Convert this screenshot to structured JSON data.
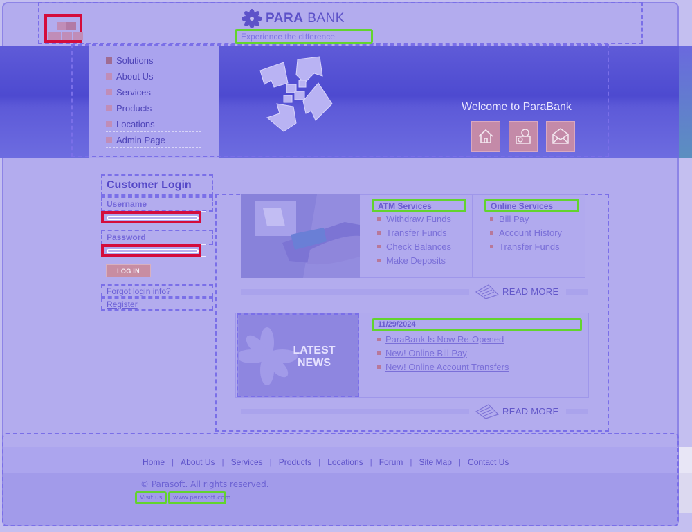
{
  "header": {
    "brand_prefix": "PARA",
    "brand_suffix": "BANK",
    "tagline": "Experience the difference"
  },
  "menu": {
    "items": [
      {
        "label": "Solutions"
      },
      {
        "label": "About Us"
      },
      {
        "label": "Services"
      },
      {
        "label": "Products"
      },
      {
        "label": "Locations"
      },
      {
        "label": "Admin Page"
      }
    ]
  },
  "banner": {
    "welcome": "Welcome to ParaBank",
    "icons": [
      "home-icon",
      "about-icon",
      "contact-icon"
    ]
  },
  "login": {
    "title": "Customer Login",
    "username_label": "Username",
    "username_value": "",
    "password_label": "Password",
    "password_value": "",
    "button": "LOG IN",
    "forgot": "Forgot login info?",
    "register": "Register"
  },
  "services": {
    "atm_heading": "ATM Services",
    "atm_items": [
      "Withdraw Funds",
      "Transfer Funds",
      "Check Balances",
      "Make Deposits"
    ],
    "online_heading": "Online Services",
    "online_items": [
      "Bill Pay",
      "Account History",
      "Transfer Funds"
    ],
    "read_more": "READ MORE"
  },
  "news": {
    "image_text_line1": "LATEST",
    "image_text_line2": "NEWS",
    "date": "11/29/2024",
    "items": [
      "ParaBank Is Now Re-Opened",
      "New! Online Bill Pay",
      "New! Online Account Transfers"
    ],
    "read_more": "READ MORE"
  },
  "footer": {
    "links": [
      "Home",
      "About Us",
      "Services",
      "Products",
      "Locations",
      "Forum",
      "Site Map",
      "Contact Us"
    ],
    "separator": "|",
    "copyright": "© Parasoft. All rights reserved.",
    "visit_label": "Visit us",
    "visit_url": "www.parasoft.com"
  },
  "colors": {
    "accent": "#5d52c9",
    "highlight_green": "#62d42e",
    "highlight_red": "#d40c3c",
    "bullet": "#c08db8"
  }
}
